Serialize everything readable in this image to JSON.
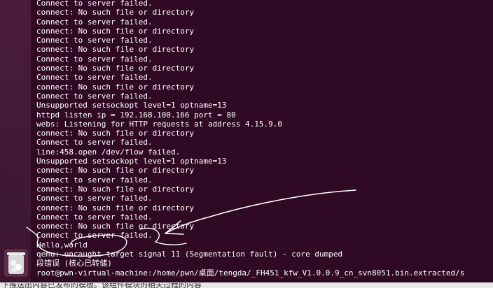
{
  "terminal": {
    "lines": [
      "Connect to server failed.",
      "connect: No such file or directory",
      "Connect to server failed.",
      "connect: No such file or directory",
      "Connect to server failed.",
      "connect: No such file or directory",
      "Connect to server failed.",
      "connect: No such file or directory",
      "Connect to server failed.",
      "connect: No such file or directory",
      "Connect to server failed.",
      "Unsupported setsockopt level=1 optname=13",
      "httpd listen ip = 192.168.100.166 port = 80",
      "webs: Listening for HTTP requests at address 4.15.9.0",
      "connect: No such file or directory",
      "Connect to server failed.",
      "line:458.open /dev/flow failed.",
      "Unsupported setsockopt level=1 optname=13",
      "connect: No such file or directory",
      "Connect to server failed.",
      "connect: No such file or directory",
      "Connect to server failed.",
      "connect: No such file or directory",
      "Connect to server failed.",
      "connect: No such file or directory",
      "Connect to server failed.",
      "Hello,world",
      "qemu: uncaught target signal 11 (Segmentation fault) - core dumped",
      "段错误 (核心已转储)",
      "root@pwn-virtual-machine:/home/pwn/桌面/tengda/_FH451_kfw_V1.0.0.9_cn_svn8051.bin.extracted/s"
    ]
  },
  "bottom_bar": {
    "text": "下推送出内容已发布的模板。该组件模块的相关过程的内容"
  },
  "colors": {
    "terminal_bg": "#300a24",
    "text": "#ffffff",
    "annotation": "#ffffff"
  }
}
